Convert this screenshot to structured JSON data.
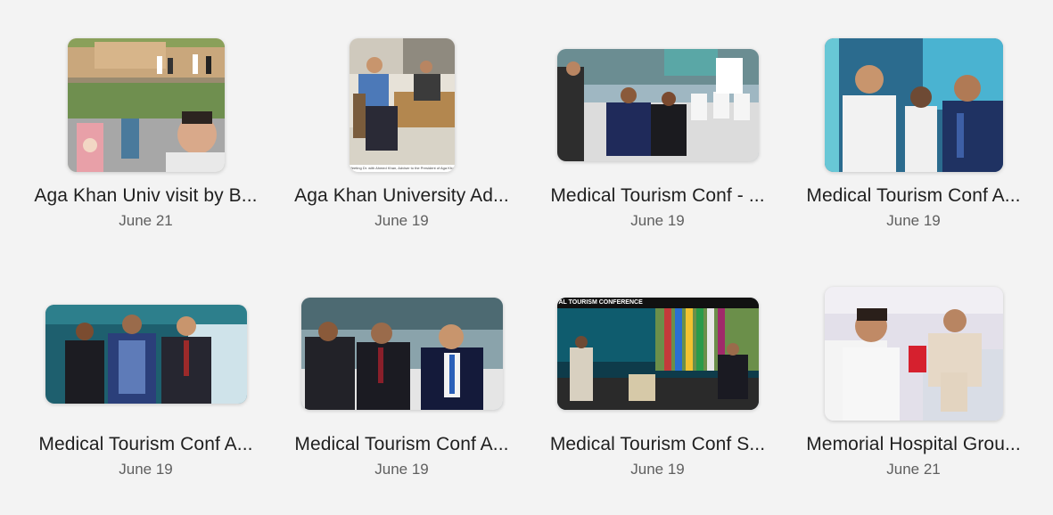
{
  "albums": [
    {
      "title": "Aga Khan Univ visit by B...",
      "date": "June 21",
      "photo": "outdoor-campus-selfie",
      "caption": ""
    },
    {
      "title": "Aga Khan University Ad...",
      "date": "June 19",
      "photo": "man-seated-at-table",
      "caption": "Meeting Dr. with Ahmed Khan, Adviser to the President of Aga Khan Uni"
    },
    {
      "title": "Medical Tourism Conf - ...",
      "date": "June 19",
      "photo": "conference-seated-audience",
      "caption": ""
    },
    {
      "title": "Medical Tourism Conf A...",
      "date": "June 19",
      "photo": "three-men-blue-backdrop",
      "caption": ""
    },
    {
      "title": "Medical Tourism Conf A...",
      "date": "June 19",
      "photo": "group-standing-portrait",
      "caption": ""
    },
    {
      "title": "Medical Tourism Conf A...",
      "date": "June 19",
      "photo": "seated-guests-front-row",
      "caption": ""
    },
    {
      "title": "Medical Tourism Conf S...",
      "date": "June 19",
      "photo": "stage-speaker-banner",
      "caption": "AL TOURISM CONFERENCE"
    },
    {
      "title": "Memorial Hospital Grou...",
      "date": "June 21",
      "photo": "hospital-bed-selfie",
      "caption": ""
    }
  ],
  "colors": {
    "background": "#f3f3f3",
    "title": "#1f1f1f",
    "date": "#5f5f5f"
  }
}
